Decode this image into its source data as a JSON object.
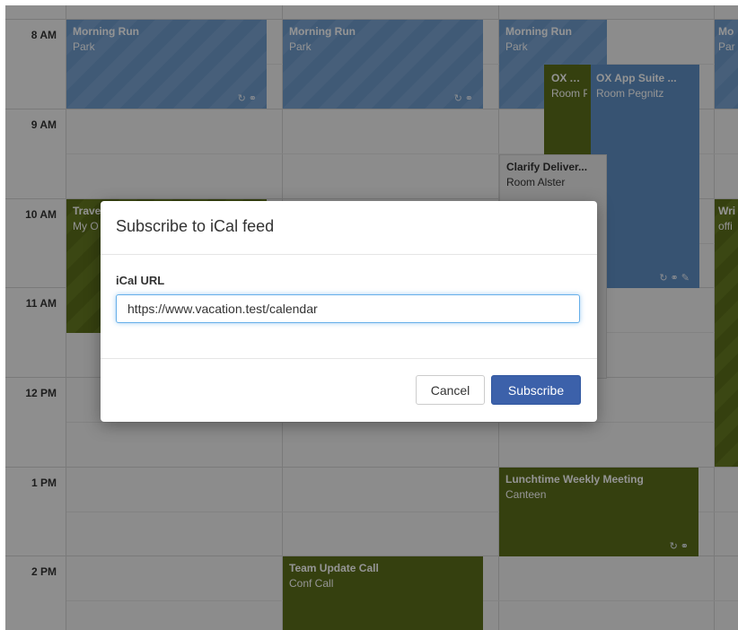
{
  "time_labels": [
    "8 AM",
    "9 AM",
    "10 AM",
    "11 AM",
    "12 PM",
    "1 PM",
    "2 PM"
  ],
  "appointments": {
    "run1": {
      "title": "Morning Run",
      "location": "Park"
    },
    "run2": {
      "title": "Morning Run",
      "location": "Park"
    },
    "run3": {
      "title": "Morning Run",
      "location": "Park"
    },
    "run4": {
      "title": "Mo",
      "location": "Par"
    },
    "oxapp_short": {
      "title": "OX App",
      "location": "Room P"
    },
    "oxapp_full": {
      "title": "OX App Suite ...",
      "location": "Room Pegnitz"
    },
    "clarify": {
      "title": "Clarify Deliver...",
      "location": "Room Alster"
    },
    "travel": {
      "title": "Trave",
      "location": "My O"
    },
    "wri": {
      "title": "Wri",
      "location": "offi"
    },
    "lunch": {
      "title": "Lunchtime Weekly Meeting",
      "location": "Canteen"
    },
    "teamcall": {
      "title": "Team Update Call",
      "location": "Conf Call"
    }
  },
  "dialog": {
    "title": "Subscribe to iCal feed",
    "field_label": "iCal URL",
    "url_value": "https://www.vacation.test/calendar",
    "cancel_label": "Cancel",
    "subscribe_label": "Subscribe"
  },
  "colors": {
    "primary_button": "#3c61aa",
    "appointment_blue": "#5f8fc4",
    "appointment_green": "#5c6e1a"
  },
  "icons": [
    "refresh-icon",
    "lock-icon",
    "tag-icon"
  ]
}
